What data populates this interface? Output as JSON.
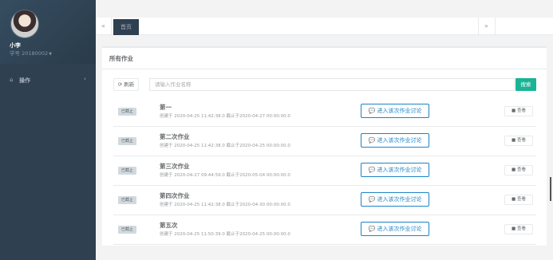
{
  "sidebar": {
    "username": "小李",
    "student_id": "学号 20180002",
    "nav": [
      {
        "icon": "home-icon",
        "label": "操作"
      }
    ]
  },
  "tabbar": {
    "home_tab": "首页",
    "prev_glyph": "«",
    "next_glyph": "»"
  },
  "panel": {
    "title": "所有作业",
    "refresh_label": "刷新",
    "search_placeholder": "请输入作业名称",
    "search_label": "搜索"
  },
  "homeworks": [
    {
      "status": "已截止",
      "name": "第一",
      "meta": "创建于 2020-04-25 11:42:38.0 截止于2020-04-27 00:00:00.0",
      "discuss_label": "进入该次作业讨论",
      "view_label": "查看"
    },
    {
      "status": "已截止",
      "name": "第二次作业",
      "meta": "创建于 2020-04-25 11:42:38.0 截止于2020-04-25 00:00:00.0",
      "discuss_label": "进入该次作业讨论",
      "view_label": "查看"
    },
    {
      "status": "已截止",
      "name": "第三次作业",
      "meta": "创建于 2020-04-27 09:44:59.0 截止于2020-05-04 00:00:00.0",
      "discuss_label": "进入该次作业讨论",
      "view_label": "查看"
    },
    {
      "status": "已截止",
      "name": "第四次作业",
      "meta": "创建于 2020-04-25 11:42:38.0 截止于2020-04-30 00:00:00.0",
      "discuss_label": "进入该次作业讨论",
      "view_label": "查看"
    },
    {
      "status": "已截止",
      "name": "第五次",
      "meta": "创建于 2020-04-25 11:50:39.0 截止于2020-04-25 00:00:00.0",
      "discuss_label": "进入该次作业讨论",
      "view_label": "查看"
    }
  ],
  "colors": {
    "sidebar_bg": "#2f4050",
    "accent_green": "#1ab394",
    "accent_blue": "#1c84c6",
    "badge_bg": "#d1dade"
  }
}
